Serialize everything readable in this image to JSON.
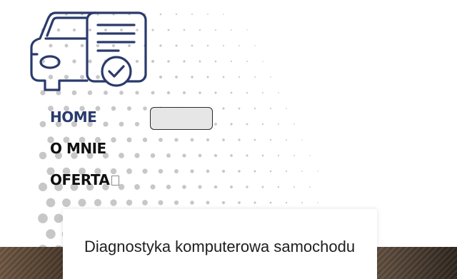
{
  "nav": {
    "home_label": "HOME",
    "about_label": "O MNIE",
    "offer_label": "OFERTA"
  },
  "search": {
    "value": ""
  },
  "submenu": {
    "items": [
      {
        "label": "Diagnostyka komputerowa samochodu"
      }
    ]
  },
  "colors": {
    "brand_navy": "#2a3a6b",
    "text_dark": "#101010",
    "dot_gray": "#c7c7c7"
  },
  "icons": {
    "logo": "car-document-check-icon",
    "dropdown": "dropdown-glyph-icon"
  }
}
